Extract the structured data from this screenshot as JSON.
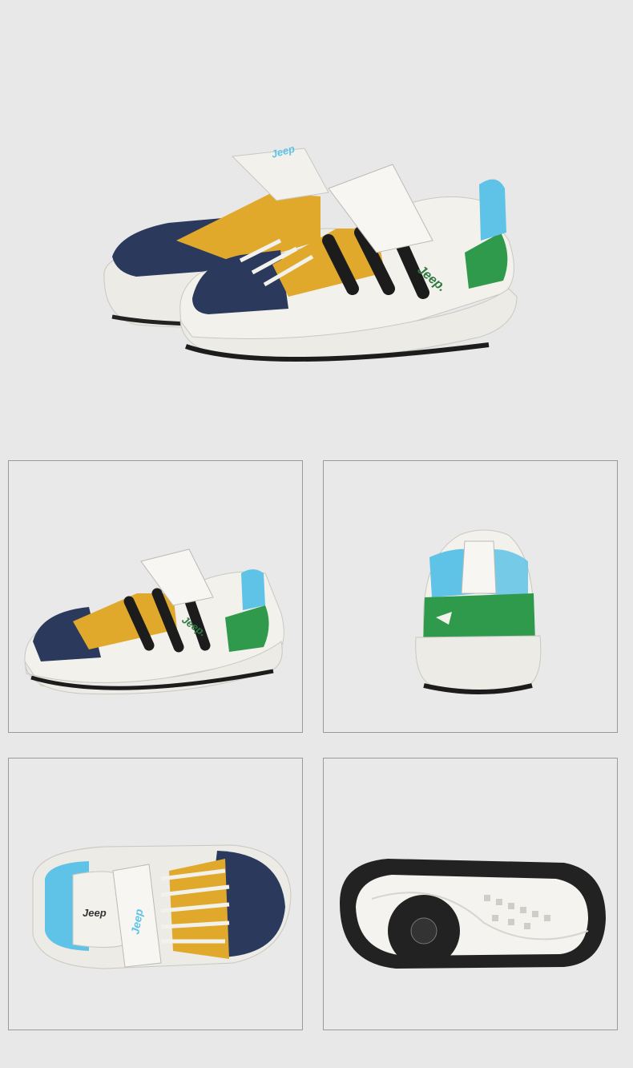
{
  "product": {
    "brand_text": "Jeep",
    "brand_text_dot": "Jeep.",
    "colors": {
      "navy": "#2b3a5c",
      "mustard": "#e1a92c",
      "green": "#2f9a4c",
      "sky": "#5ec3e6",
      "white": "#f3f1ec",
      "sole": "#ecebe6",
      "stripe": "#1c1c1c"
    }
  },
  "views": [
    {
      "name": "hero-pair"
    },
    {
      "name": "side-view"
    },
    {
      "name": "back-view"
    },
    {
      "name": "top-view"
    },
    {
      "name": "sole-view"
    }
  ]
}
